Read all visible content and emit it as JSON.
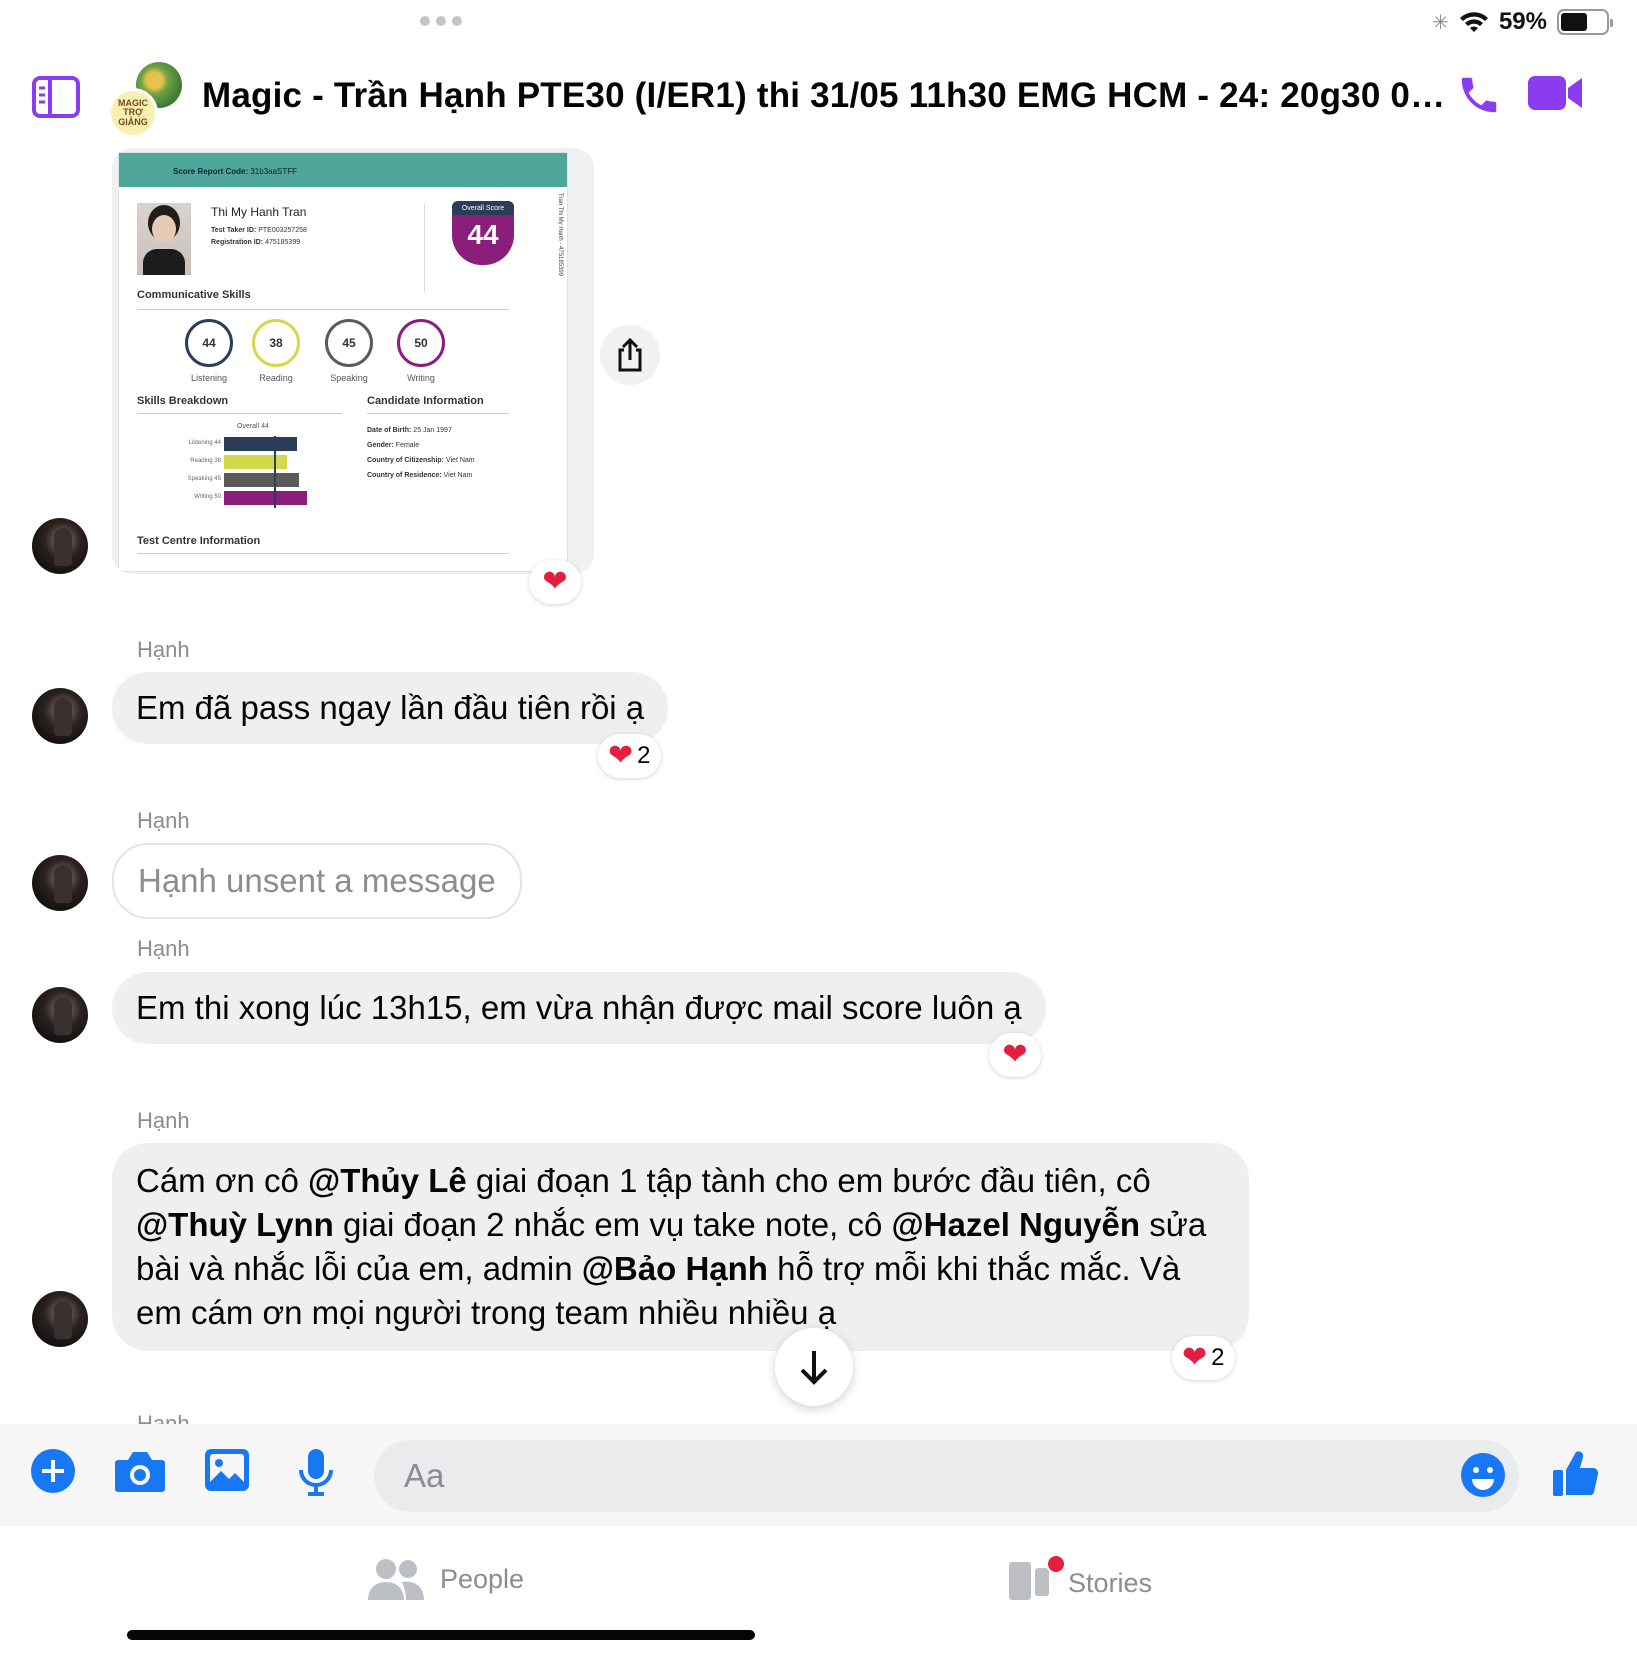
{
  "status_bar": {
    "battery": "59%",
    "battery_level": 0.59
  },
  "header": {
    "title": "Magic - Trần Hạnh PTE30 (I/ER1) thi 31/05 11h30 EMG HCM - 24: 20g30 08...",
    "group_avatar_text": "MAGIC TRỢ GIẢNG"
  },
  "score_report": {
    "code_label": "Score Report Code:",
    "code": "31b3aaSTFF",
    "candidate_name": "Thi My Hanh Tran",
    "test_taker_id_label": "Test Taker ID:",
    "test_taker_id": "PTE003257258",
    "registration_id_label": "Registration ID:",
    "registration_id": "475185399",
    "overall_label": "Overall Score",
    "overall_score": "44",
    "communicative_title": "Communicative Skills",
    "skills": [
      {
        "label": "Listening",
        "score": "44",
        "color": "#2b3d58"
      },
      {
        "label": "Reading",
        "score": "38",
        "color": "#d4d94a"
      },
      {
        "label": "Speaking",
        "score": "45",
        "color": "#5a5a5a"
      },
      {
        "label": "Writing",
        "score": "50",
        "color": "#8a1e7b"
      }
    ],
    "breakdown_title": "Skills Breakdown",
    "breakdown_overall": "Overall 44",
    "breakdown": [
      {
        "label": "Listening 44",
        "value": 44,
        "color": "#2b3d58"
      },
      {
        "label": "Reading 38",
        "value": 38,
        "color": "#d4d94a"
      },
      {
        "label": "Speaking 45",
        "value": 45,
        "color": "#5a5a5a"
      },
      {
        "label": "Writing 50",
        "value": 50,
        "color": "#8a1e7b"
      }
    ],
    "candidate_title": "Candidate Information",
    "dob_label": "Date of Birth:",
    "dob": "25 Jan 1997",
    "gender_label": "Gender:",
    "gender": "Female",
    "citizenship_label": "Country of Citizenship:",
    "citizenship": "Viet Nam",
    "residence_label": "Country of Residence:",
    "residence": "Viet Nam",
    "test_centre_title": "Test Centre Information",
    "side_text": "Tran Thi My Hanh - 475185399"
  },
  "messages": [
    {
      "sender": "Hạnh",
      "text": "Em đã pass ngay lần đầu tiên rồi ạ",
      "reaction_count": "2"
    },
    {
      "sender": "Hạnh",
      "text": "Hạnh unsent a message"
    },
    {
      "sender": "Hạnh",
      "text": "Em thi xong lúc 13h15, em vừa nhận được mail score luôn ạ"
    },
    {
      "sender": "Hạnh",
      "parts": {
        "p1": "Cám ơn cô ",
        "m1": "@Thủy Lê",
        "p2": " giai đoạn 1 tập tành cho em bước đầu tiên, cô ",
        "m2": "@Thuỳ Lynn",
        "p3": " giai đoạn 2 nhắc em vụ take note, cô ",
        "m3": "@Hazel Nguyễn",
        "p4": " sửa bài và nhắc lỗi của em, admin ",
        "m4": "@Bảo Hạnh",
        "p5": " hỗ trợ mỗi khi thắc mắc. Và em cám ơn mọi người trong team nhiều nhiều ạ"
      },
      "reaction_count": "2"
    },
    {
      "sender": "Hạnh"
    }
  ],
  "composer": {
    "placeholder": "Aa"
  },
  "tabs": {
    "people": "People",
    "stories": "Stories"
  },
  "colors": {
    "accent": "#1877f2",
    "purple": "#8b3cf0",
    "heart": "#e41e3f"
  }
}
